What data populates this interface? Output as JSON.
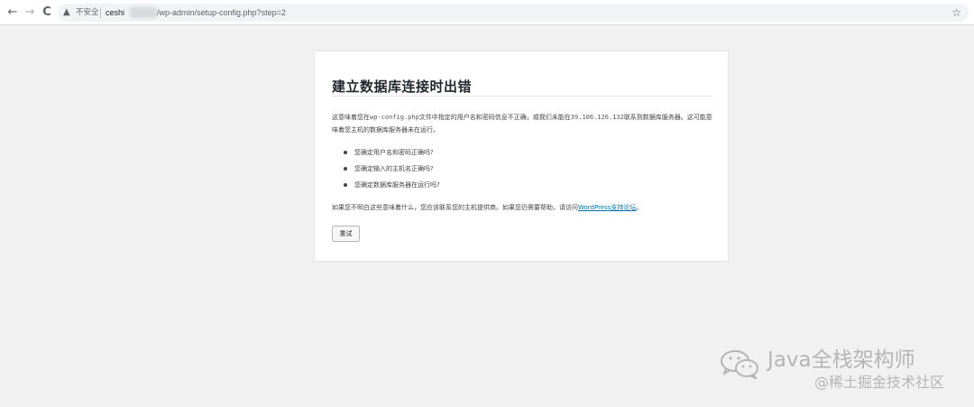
{
  "browser": {
    "insecure_label": "不安全",
    "url_host": "ceshi",
    "url_path": "/wp-admin/setup-config.php?step=2",
    "back_glyph": "←",
    "forward_glyph": "→",
    "reload_glyph": "C",
    "warning_glyph": "▲",
    "star_glyph": "☆"
  },
  "page": {
    "title": "建立数据库连接时出错",
    "intro_prefix": "这意味着您在",
    "intro_file": "wp-config.php",
    "intro_middle": "文件中指定的用户名和密码信息不正确，或我们未能在",
    "intro_ip": "39.106.126.132",
    "intro_suffix": "联系到数据库服务器。这可能意味着您主机的数据库服务器未在运行。",
    "bullets": [
      "您确定用户名和密码正确吗?",
      "您确定输入的主机名正确吗?",
      "您确定数据库服务器在运行吗?"
    ],
    "help_prefix": "如果您不明白这些意味着什么，您应该联系您的主机提供商。如果您仍需要帮助，请访问",
    "help_link": "WordPress支持论坛",
    "help_suffix": "。",
    "retry_button": "重试"
  },
  "watermark": {
    "title": "Java全栈架构师",
    "subtitle": "@稀土掘金技术社区"
  },
  "colors": {
    "background": "#f1f1f1",
    "card": "#ffffff",
    "link": "#0073aa",
    "heading": "#23282d"
  }
}
